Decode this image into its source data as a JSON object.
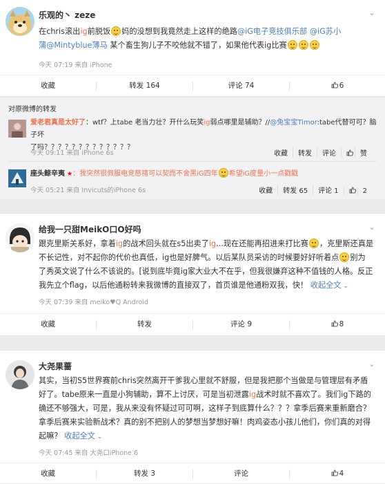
{
  "post1": {
    "username": "乐观的丶 zeze",
    "content_a": "在chris滚出",
    "content_b": "ig",
    "content_c": "前脱饭",
    "content_d": "妈的没想到我竟然走上这样的绝路",
    "mention1": "@iG电子竞技俱乐部",
    "mention2": "@iG苏小",
    "content_line2_a": "蒲@Mintyblue薄马",
    "content_line2_b": " 某个畜生狗儿子不咬他就不错了，如果他代表ig比赛",
    "meta": "今天 07:19 来自 iPhone",
    "actions": {
      "fav": "收藏",
      "repost": "转发 164",
      "comment": "评论 74",
      "like": "6"
    }
  },
  "retweets": {
    "title": "对原微博的转发",
    "items": [
      {
        "name": "爱老君真是太好了",
        "text_a": "：wtf？上tabe 老当力壮？开什么玩笑",
        "text_b": "ig",
        "text_c": "弱点哪里是辅助？//",
        "mention": "@兔宝宝Timor",
        "text_d": ":tabe代替可可？脑子坏",
        "line2": "了吗？？？？？？？？？？？？？",
        "meta": "今天 09:11 来自 iPhone 6s",
        "acts": [
          "收藏",
          "转发",
          "评论",
          "赞"
        ]
      },
      {
        "name": "座头鲸辛夷",
        "text": "：我突然很佩服电竞慈禧可以契而不舍黑",
        "text_b": "iG",
        "text_c": "四年",
        "text_d": "希望iG度量小一点戳戳",
        "meta": "今天 05:21 来自 Invicuts的iPhone 6s",
        "acts": [
          "收藏",
          "转发 65",
          "评论 1",
          "2"
        ]
      }
    ]
  },
  "post2": {
    "username": "给我一只甜MeikO口O好吗",
    "line1_a": "跟克里斯关系好，拿着",
    "line1_b": "ig",
    "line1_c": "的战术回头就在s5出卖了",
    "line1_d": "ig",
    "line1_e": "...现在还能再招进来打比赛",
    "line1_f": "，克里斯还真是",
    "line2": "不长记性，对不起你的代价也真低，ig也是好脾气。以后某队员采访的时候要好好听着点",
    "line2_b": "别为",
    "line3": "了秀英文说了什么不该说的。[说到底毕竟ig家大业大不在乎，但我很嫌弃这种不值钱的人格。反正",
    "line4": "我先立个flag，以后他通粉转来我微博的直接双了，首页谁是他通粉双我，快！",
    "more": "收起全文",
    "meta": "今天 07:39 来自 meiko♥Q Android",
    "actions": {
      "fav": "收藏",
      "repost": "转发",
      "comment": "评论 9",
      "like": "8"
    }
  },
  "post3": {
    "username": "大尧果蔷",
    "line1": "其实，当初S5世界赛前chris突然离开干爹我心里就不舒服，但是我把那个当做是与管理层有矛盾",
    "line2_a": "好了。tabe原来一直是小狗辅助，算不上讨厌，可是当初泄露",
    "line2_b": "ig",
    "line2_c": "战术时就不喜欢了。我们ig下路的",
    "line3": "确还不够强大，可是，我从来没有怀疑过可可啊，这样子到底算什么？？？拿季后赛来重新磨合？",
    "line4": "拿季后赛来实验新战术？真的别不把别人的梦想当梦想好嘛！肉鸡姿态小孩儿他们，你们真的对得",
    "line5": "起嘛？",
    "more": "收起全文",
    "meta": "今天 07:45 来自 大尧口iPhone 6",
    "actions": {
      "fav": "收藏",
      "repost": "转发 3",
      "comment": "评论",
      "like": "4"
    }
  }
}
